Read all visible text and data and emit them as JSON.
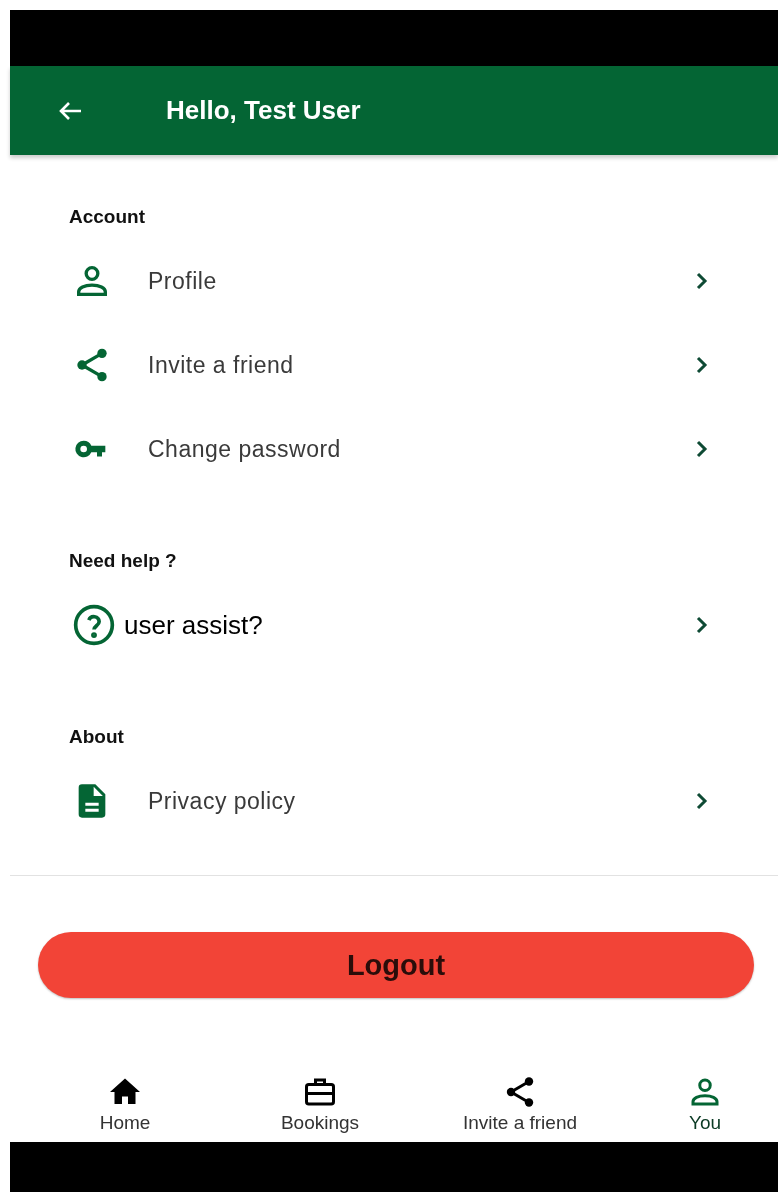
{
  "header": {
    "title": "Hello, Test User"
  },
  "sections": [
    {
      "title": "Account",
      "items": [
        {
          "kind": "person",
          "label": "Profile"
        },
        {
          "kind": "share",
          "label": "Invite a friend"
        },
        {
          "kind": "key",
          "label": "Change password"
        }
      ]
    },
    {
      "title": "Need help ?",
      "items": [
        {
          "kind": "help",
          "label": "user assist?"
        }
      ]
    },
    {
      "title": "About",
      "items": [
        {
          "kind": "document",
          "label": "Privacy policy"
        }
      ]
    }
  ],
  "logout_button": "Logout",
  "bottom_nav": [
    {
      "kind": "home",
      "label": "Home",
      "selected": false
    },
    {
      "kind": "briefcase",
      "label": "Bookings",
      "selected": false
    },
    {
      "kind": "share",
      "label": "Invite a friend",
      "selected": false
    },
    {
      "kind": "person",
      "label": "You",
      "selected": true
    }
  ]
}
